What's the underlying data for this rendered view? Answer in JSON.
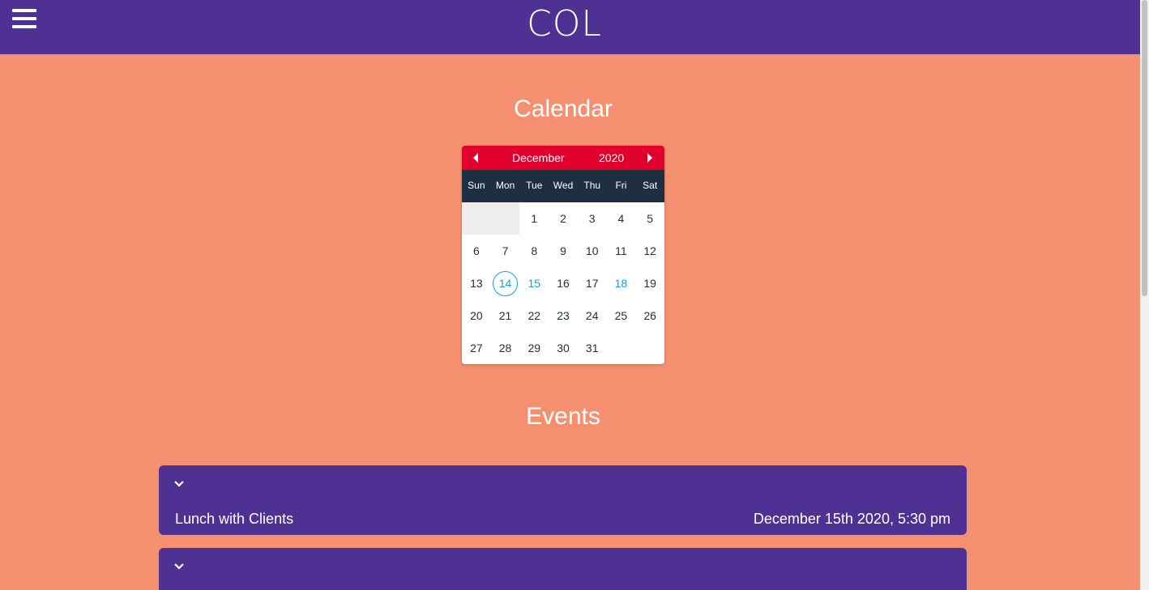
{
  "header": {
    "title": "COL"
  },
  "calendar_section": {
    "heading": "Calendar"
  },
  "calendar": {
    "month": "December",
    "year": "2020",
    "weekdays": [
      "Sun",
      "Mon",
      "Tue",
      "Wed",
      "Thu",
      "Fri",
      "Sat"
    ],
    "days": [
      "1",
      "2",
      "3",
      "4",
      "5",
      "6",
      "7",
      "8",
      "9",
      "10",
      "11",
      "12",
      "13",
      "14",
      "15",
      "16",
      "17",
      "18",
      "19",
      "20",
      "21",
      "22",
      "23",
      "24",
      "25",
      "26",
      "27",
      "28",
      "29",
      "30",
      "31"
    ],
    "today": "14",
    "event_days": [
      "15",
      "18"
    ],
    "colors": {
      "header": "#e2002d",
      "weekday_bar": "#1f2f42",
      "highlight": "#1a9fd0"
    }
  },
  "events_section": {
    "heading": "Events"
  },
  "events": [
    {
      "name": "Lunch with Clients",
      "date": "December 15th 2020, 5:30 pm"
    },
    {
      "name": "",
      "date": ""
    }
  ],
  "colors": {
    "topbar": "#4f3193",
    "background": "#f4906f"
  }
}
